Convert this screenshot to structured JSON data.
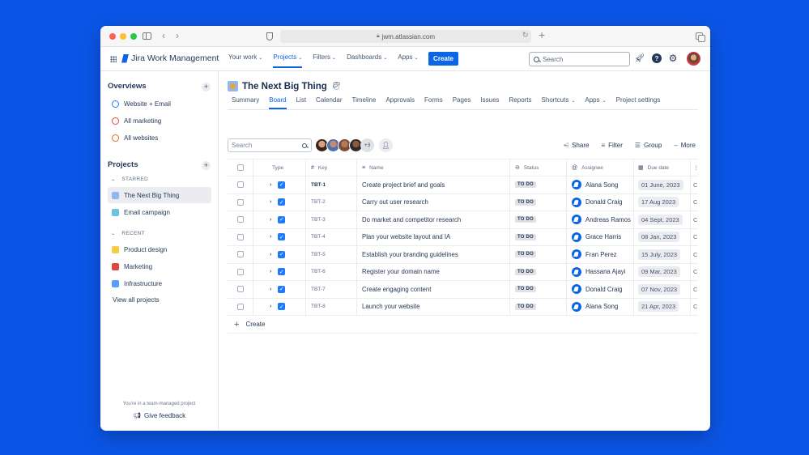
{
  "browser": {
    "url": "jwm.atlassian.com",
    "dot_colors": [
      "#ff5f57",
      "#febc2e",
      "#28c840"
    ]
  },
  "topnav": {
    "logo_text": "Jira Work Management",
    "items": [
      {
        "label": "Your work"
      },
      {
        "label": "Projects"
      },
      {
        "label": "Filters"
      },
      {
        "label": "Dashboards"
      },
      {
        "label": "Apps"
      }
    ],
    "create_label": "Create",
    "search_placeholder": "Search",
    "accent": "#0c66e4"
  },
  "sidebar": {
    "overviews_title": "Overviews",
    "overviews": [
      {
        "label": "Website + Email",
        "color": "#1d7afc"
      },
      {
        "label": "All marketing",
        "color": "#e2483d"
      },
      {
        "label": "All websites",
        "color": "#e56910"
      }
    ],
    "projects_title": "Projects",
    "starred_label": "STARRED",
    "starred": [
      {
        "label": "The Next Big Thing",
        "color": "#8fb8ed"
      },
      {
        "label": "Email campaign",
        "color": "#6cc3e0"
      }
    ],
    "recent_label": "RECENT",
    "recent": [
      {
        "label": "Product design",
        "color": "#f5cd47"
      },
      {
        "label": "Marketing",
        "color": "#e2483d"
      },
      {
        "label": "Infrastructure",
        "color": "#579dff"
      }
    ],
    "view_all": "View all projects",
    "footer_note": "You're in a team-managed project",
    "feedback": "Give feedback"
  },
  "project": {
    "title": "The Next Big Thing",
    "tabs": [
      "Summary",
      "Board",
      "List",
      "Calendar",
      "Timeline",
      "Approvals",
      "Forms",
      "Pages",
      "Issues",
      "Reports",
      "Shortcuts",
      "Apps",
      "Project settings"
    ],
    "active_tab": "Board",
    "search_placeholder": "Search",
    "more_people": "+3",
    "actions": {
      "share": "Share",
      "filter": "Filter",
      "group": "Group",
      "more": "More"
    }
  },
  "table": {
    "headers": {
      "type": "Type",
      "key": "Key",
      "name": "Name",
      "status": "Status",
      "assignee": "Assignee",
      "due": "Due date"
    },
    "rows": [
      {
        "key": "TBT-1",
        "name": "Create project brief and goals",
        "status": "TO DO",
        "assignee": "Alana Song",
        "due": "01 June, 2023",
        "extra": "C"
      },
      {
        "key": "TBT-2",
        "name": "Carry out user research",
        "status": "TO DO",
        "assignee": "Donald Craig",
        "due": "17 Aug 2023",
        "extra": "C"
      },
      {
        "key": "TBT-3",
        "name": "Do market and competitor research",
        "status": "TO DO",
        "assignee": "Andreas Ramos",
        "due": "04 Sept, 2023",
        "extra": "C"
      },
      {
        "key": "TBT-4",
        "name": "Plan your website layout and IA",
        "status": "TO DO",
        "assignee": "Grace Harris",
        "due": "08 Jan, 2023",
        "extra": "C"
      },
      {
        "key": "TBT-5",
        "name": "Establish your branding guidelines",
        "status": "TO DO",
        "assignee": "Fran Perez",
        "due": "15 July, 2023",
        "extra": "C"
      },
      {
        "key": "TBT-6",
        "name": "Register your domain name",
        "status": "TO DO",
        "assignee": "Hassana Ajayi",
        "due": "09 Mar, 2023",
        "extra": "C"
      },
      {
        "key": "TBT-7",
        "name": "Create engaging content",
        "status": "TO DO",
        "assignee": "Donald Craig",
        "due": "07 Nov, 2023",
        "extra": "C"
      },
      {
        "key": "TBT-8",
        "name": "Launch your website",
        "status": "TO DO",
        "assignee": "Alana Song",
        "due": "21 Apr, 2023",
        "extra": "C"
      }
    ],
    "create_label": "Create"
  }
}
